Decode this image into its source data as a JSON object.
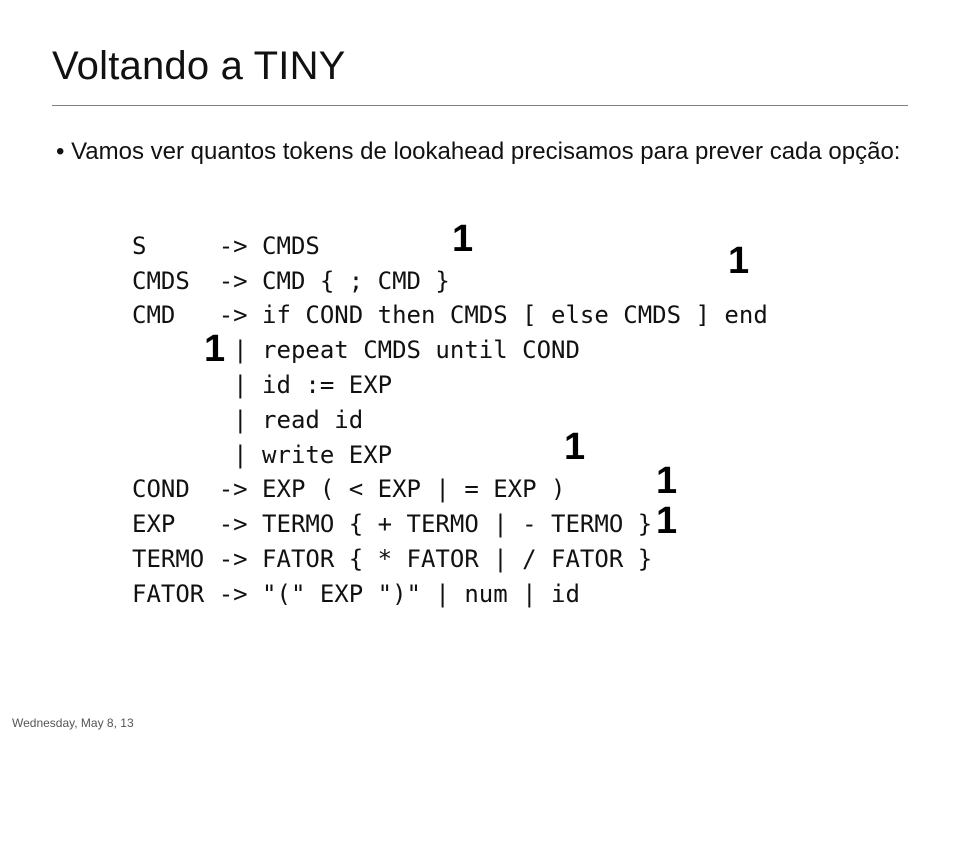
{
  "title": "Voltando a TINY",
  "bullet": "Vamos ver quantos tokens de lookahead precisamos para prever cada opção:",
  "grammar": {
    "l0": "S     -> CMDS",
    "l1": "CMDS  -> CMD { ; CMD }",
    "l2": "CMD   -> if COND then CMDS [ else CMDS ] end",
    "l3": "       | repeat CMDS until COND",
    "l4": "       | id := EXP",
    "l5": "       | read id",
    "l6": "       | write EXP",
    "l7": "COND  -> EXP ( < EXP | = EXP )",
    "l8": "EXP   -> TERMO { + TERMO | - TERMO }",
    "l9": "TERMO -> FATOR { * FATOR | / FATOR }",
    "l10": "FATOR -> \"(\" EXP \")\" | num | id"
  },
  "annotations": {
    "a0": "1",
    "a1": "1",
    "a2": "1",
    "a3": "1",
    "a4": "1",
    "a5": "1"
  },
  "footer": "Wednesday, May 8, 13"
}
